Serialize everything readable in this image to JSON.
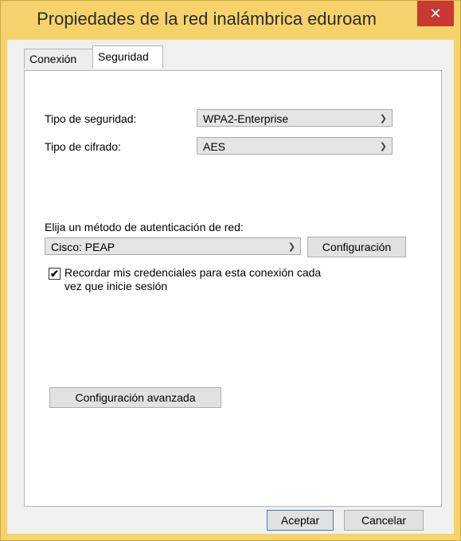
{
  "window": {
    "title": "Propiedades de la red inalámbrica eduroam",
    "close_glyph": "✕"
  },
  "tabs": [
    {
      "label": "Conexión",
      "active": false
    },
    {
      "label": "Seguridad",
      "active": true
    }
  ],
  "security": {
    "type_label": "Tipo de seguridad:",
    "type_value": "WPA2-Enterprise",
    "cipher_label": "Tipo de cifrado:",
    "cipher_value": "AES",
    "auth_label": "Elija un método de autenticación de red:",
    "auth_value": "Cisco: PEAP",
    "config_button": "Configuración",
    "remember_label_line1": "Recordar mis credenciales para esta conexión cada",
    "remember_label_line2": "vez que inicie sesión",
    "remember_checked": true,
    "advanced_button": "Configuración avanzada",
    "dropdown_icon": "chevron-down-icon",
    "check_glyph": "✔"
  },
  "footer": {
    "ok_button": "Aceptar",
    "cancel_button": "Cancelar"
  },
  "colors": {
    "titlebar": "#f5d36a",
    "close_button": "#c7382e"
  }
}
